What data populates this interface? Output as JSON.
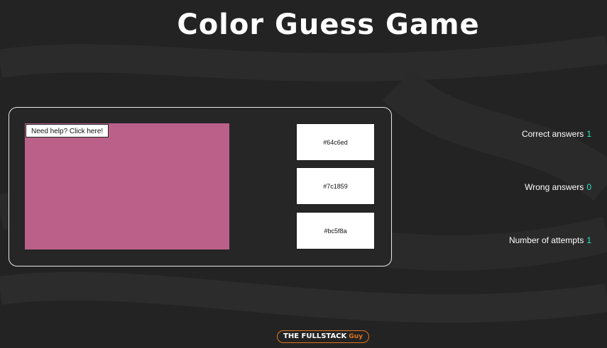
{
  "title": "Color Guess Game",
  "colors": {
    "background": "#232323",
    "swatch": "#bb6189",
    "stat_value": "#2ee6c0",
    "brand_accent": "#e0761f"
  },
  "game": {
    "help_label": "Need help? Click here!",
    "options": [
      "#64c6ed",
      "#7c1859",
      "#bc5f8a"
    ]
  },
  "stats": {
    "correct_label": "Correct answers",
    "correct_value": "1",
    "wrong_label": "Wrong answers",
    "wrong_value": "0",
    "attempts_label": "Number of attempts",
    "attempts_value": "1"
  },
  "brand": {
    "main": "THE FULLSTACK",
    "accent": "Guy"
  }
}
